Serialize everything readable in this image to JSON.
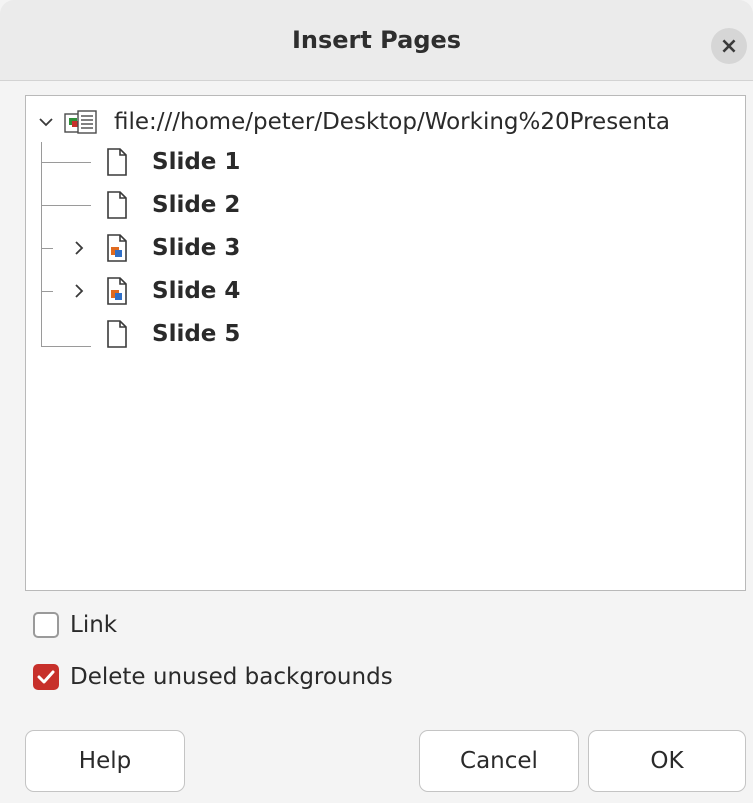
{
  "dialog": {
    "title": "Insert Pages",
    "close_icon": "close-icon"
  },
  "tree": {
    "root": {
      "label": "file:///home/peter/Desktop/Working%20Presenta",
      "expanded": true,
      "icon": "presentation-file-icon"
    },
    "slides": [
      {
        "label": "Slide 1",
        "icon": "blank-page-icon",
        "expandable": false
      },
      {
        "label": "Slide 2",
        "icon": "blank-page-icon",
        "expandable": false
      },
      {
        "label": "Slide 3",
        "icon": "slide-with-objects-icon",
        "expandable": true
      },
      {
        "label": "Slide 4",
        "icon": "slide-with-objects-icon",
        "expandable": true
      },
      {
        "label": "Slide 5",
        "icon": "blank-page-icon",
        "expandable": false
      }
    ]
  },
  "options": {
    "link": {
      "label": "Link",
      "checked": false
    },
    "delete_unused_backgrounds": {
      "label": "Delete unused backgrounds",
      "checked": true
    }
  },
  "buttons": {
    "help": "Help",
    "cancel": "Cancel",
    "ok": "OK"
  },
  "colors": {
    "accent": "#c7302b",
    "background": "#f4f4f4",
    "titlebar": "#ebebeb"
  }
}
